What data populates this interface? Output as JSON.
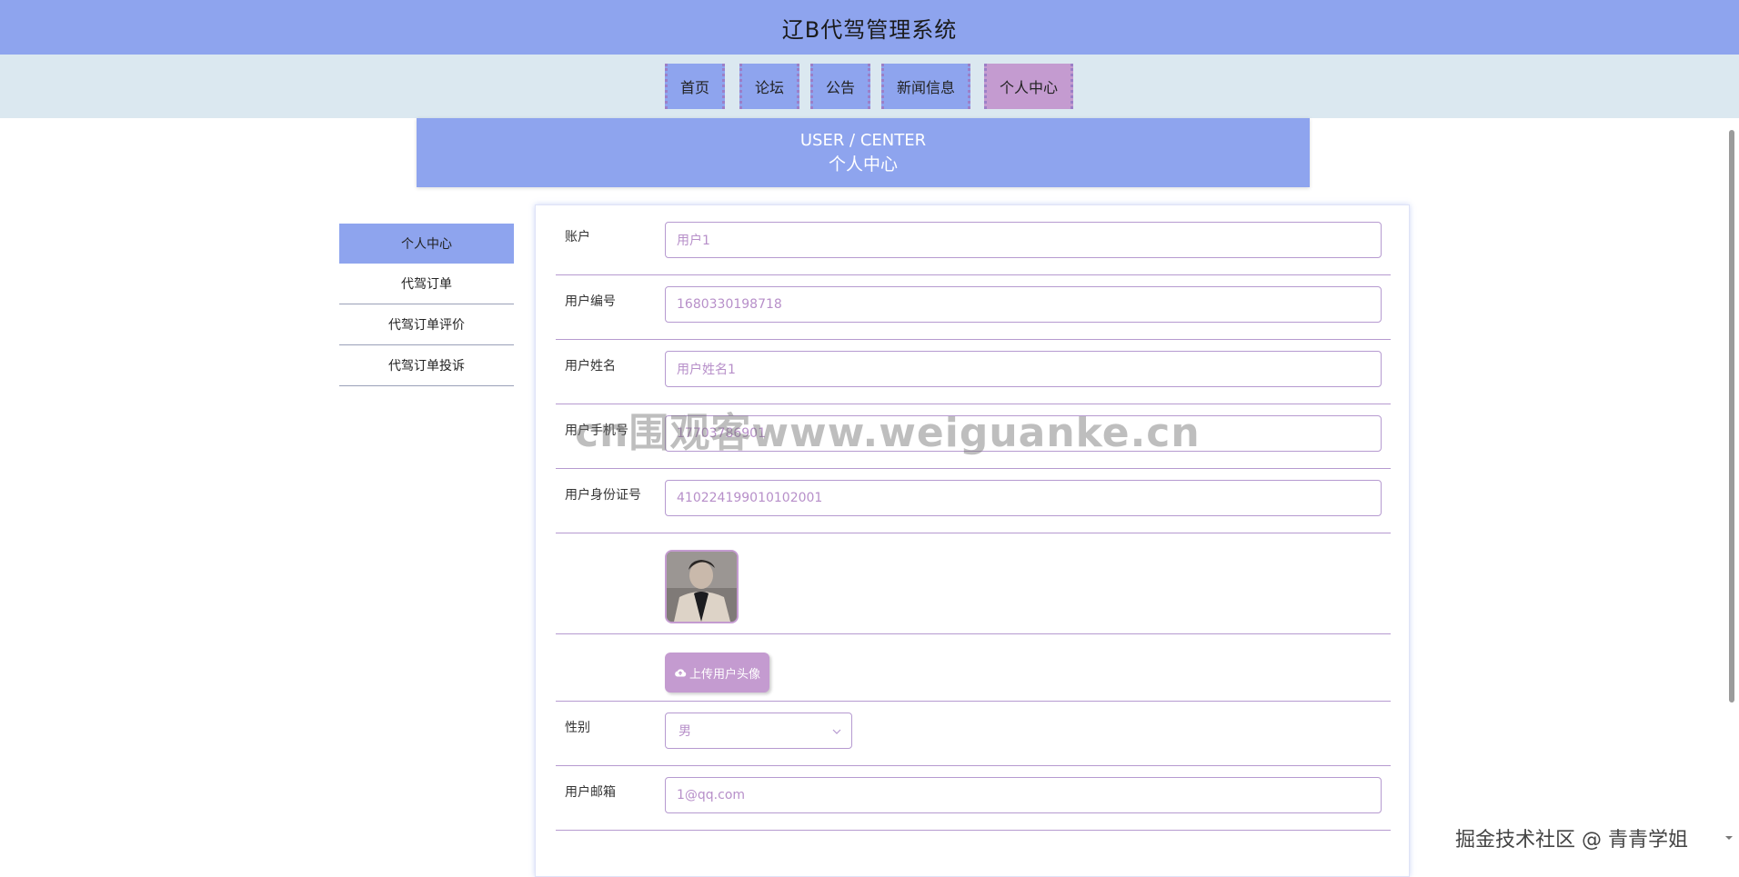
{
  "header": {
    "title": "辽B代驾管理系统"
  },
  "nav": {
    "items": [
      {
        "label": "首页"
      },
      {
        "label": "论坛"
      },
      {
        "label": "公告"
      },
      {
        "label": "新闻信息"
      },
      {
        "label": "个人中心"
      }
    ],
    "active": "个人中心"
  },
  "banner": {
    "en": "USER / CENTER",
    "cn": "个人中心"
  },
  "sidebar": {
    "items": [
      {
        "label": "个人中心"
      },
      {
        "label": "代驾订单"
      },
      {
        "label": "代驾订单评价"
      },
      {
        "label": "代驾订单投诉"
      }
    ],
    "active": "个人中心"
  },
  "form": {
    "account": {
      "label": "账户",
      "value": "用户1"
    },
    "user_no": {
      "label": "用户编号",
      "value": "1680330198718"
    },
    "user_name": {
      "label": "用户姓名",
      "value": "用户姓名1"
    },
    "phone": {
      "label": "用户手机号",
      "value": "17703786901"
    },
    "id_card": {
      "label": "用户身份证号",
      "value": "410224199010102001"
    },
    "upload_label": "上传用户头像",
    "gender": {
      "label": "性别",
      "value": "男"
    },
    "email": {
      "label": "用户邮箱",
      "value": "1@qq.com"
    }
  },
  "icons": {
    "upload": "cloud-upload-icon",
    "select": "chevron-down-icon"
  },
  "overlay": {
    "watermark": "cn围观客www.weiguanke.cn",
    "credit": "掘金技术社区 @ 青青学姐"
  },
  "colors": {
    "header": "#8ea4ee",
    "navbar": "#dbe8f0",
    "accent": "#c49bd0",
    "field_text": "#b78fc9"
  }
}
